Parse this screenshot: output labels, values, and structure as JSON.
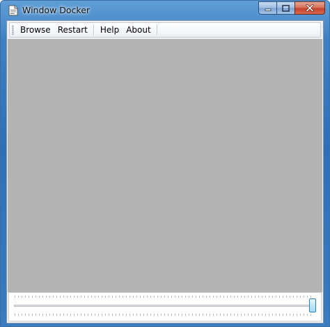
{
  "window": {
    "title": "Window Docker",
    "icon": "document-app-icon"
  },
  "caption": {
    "minimize_icon": "minimize-icon",
    "maximize_icon": "maximize-icon",
    "close_icon": "close-icon"
  },
  "menu": {
    "items": [
      "Browse",
      "Restart",
      "Help",
      "About"
    ]
  },
  "slider": {
    "value_fraction": 1.0
  },
  "colors": {
    "dock_background": "#b3b3b3",
    "window_frame": "#3f80c4",
    "close_button": "#c4422a"
  }
}
